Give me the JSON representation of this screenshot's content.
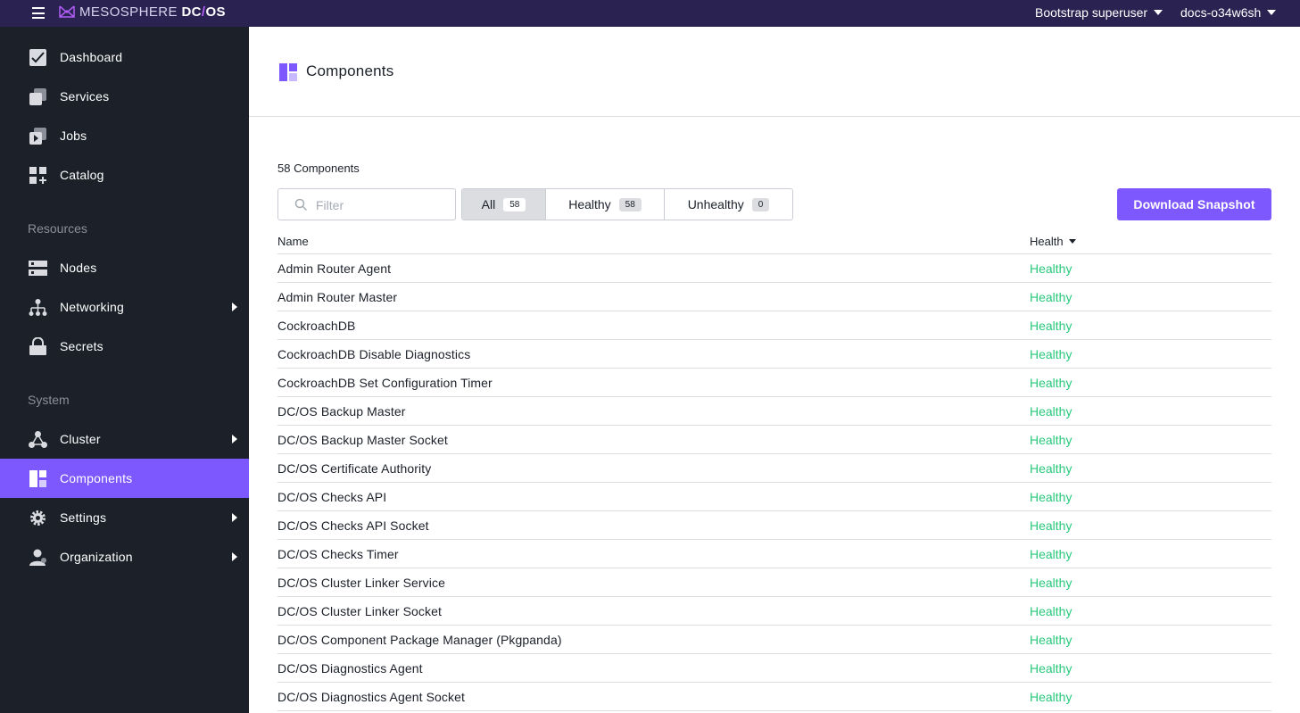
{
  "topbar": {
    "brand_prefix": "MESOSPHERE ",
    "brand_dc": "DC",
    "brand_slash": "/",
    "brand_os": "OS",
    "user_menu": "Bootstrap superuser",
    "cluster_menu": "docs-o34w6sh"
  },
  "sidebar": {
    "items_top": [
      {
        "label": "Dashboard",
        "icon": "dashboard-icon"
      },
      {
        "label": "Services",
        "icon": "services-icon"
      },
      {
        "label": "Jobs",
        "icon": "jobs-icon"
      },
      {
        "label": "Catalog",
        "icon": "catalog-icon"
      }
    ],
    "section_resources": "Resources",
    "items_resources": [
      {
        "label": "Nodes",
        "icon": "nodes-icon"
      },
      {
        "label": "Networking",
        "icon": "networking-icon",
        "has_children": true
      },
      {
        "label": "Secrets",
        "icon": "secrets-icon"
      }
    ],
    "section_system": "System",
    "items_system": [
      {
        "label": "Cluster",
        "icon": "cluster-icon",
        "has_children": true
      },
      {
        "label": "Components",
        "icon": "components-icon",
        "active": true
      },
      {
        "label": "Settings",
        "icon": "settings-icon",
        "has_children": true
      },
      {
        "label": "Organization",
        "icon": "organization-icon",
        "has_children": true
      }
    ]
  },
  "page": {
    "title": "Components",
    "count_text": "58 Components",
    "filter_placeholder": "Filter",
    "filter_value": "",
    "tabs": [
      {
        "label": "All",
        "count": "58",
        "active": true
      },
      {
        "label": "Healthy",
        "count": "58"
      },
      {
        "label": "Unhealthy",
        "count": "0"
      }
    ],
    "snapshot_button": "Download Snapshot"
  },
  "table": {
    "columns": {
      "name": "Name",
      "health": "Health"
    },
    "sort_column": "Health",
    "rows": [
      {
        "name": "Admin Router Agent",
        "health": "Healthy"
      },
      {
        "name": "Admin Router Master",
        "health": "Healthy"
      },
      {
        "name": "CockroachDB",
        "health": "Healthy"
      },
      {
        "name": "CockroachDB Disable Diagnostics",
        "health": "Healthy"
      },
      {
        "name": "CockroachDB Set Configuration Timer",
        "health": "Healthy"
      },
      {
        "name": "DC/OS Backup Master",
        "health": "Healthy"
      },
      {
        "name": "DC/OS Backup Master Socket",
        "health": "Healthy"
      },
      {
        "name": "DC/OS Certificate Authority",
        "health": "Healthy"
      },
      {
        "name": "DC/OS Checks API",
        "health": "Healthy"
      },
      {
        "name": "DC/OS Checks API Socket",
        "health": "Healthy"
      },
      {
        "name": "DC/OS Checks Timer",
        "health": "Healthy"
      },
      {
        "name": "DC/OS Cluster Linker Service",
        "health": "Healthy"
      },
      {
        "name": "DC/OS Cluster Linker Socket",
        "health": "Healthy"
      },
      {
        "name": "DC/OS Component Package Manager (Pkgpanda)",
        "health": "Healthy"
      },
      {
        "name": "DC/OS Diagnostics Agent",
        "health": "Healthy"
      },
      {
        "name": "DC/OS Diagnostics Agent Socket",
        "health": "Healthy"
      }
    ]
  },
  "colors": {
    "topbar": "#2a2251",
    "sidebar": "#1b2029",
    "accent": "#7d58ff",
    "healthy": "#27c97b"
  }
}
